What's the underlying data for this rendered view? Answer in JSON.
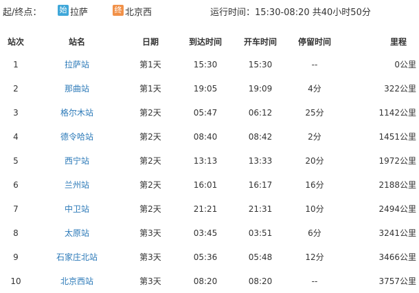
{
  "header": {
    "endpoints_label": "起/终点：",
    "start_badge": "始",
    "start_station": "拉萨",
    "end_badge": "终",
    "end_station": "北京西",
    "runtime": "运行时间：15:30-08:20 共40小时50分"
  },
  "colors": {
    "start_badge": "#3fa7d9",
    "end_badge": "#f19149",
    "station_link": "#2b79b8"
  },
  "table": {
    "headers": [
      "站次",
      "站名",
      "日期",
      "到达时间",
      "开车时间",
      "停留时间",
      "里程"
    ],
    "rows": [
      [
        "1",
        "拉萨站",
        "第1天",
        "15:30",
        "15:30",
        "--",
        "0公里"
      ],
      [
        "2",
        "那曲站",
        "第1天",
        "19:05",
        "19:09",
        "4分",
        "322公里"
      ],
      [
        "3",
        "格尔木站",
        "第2天",
        "05:47",
        "06:12",
        "25分",
        "1142公里"
      ],
      [
        "4",
        "德令哈站",
        "第2天",
        "08:40",
        "08:42",
        "2分",
        "1451公里"
      ],
      [
        "5",
        "西宁站",
        "第2天",
        "13:13",
        "13:33",
        "20分",
        "1972公里"
      ],
      [
        "6",
        "兰州站",
        "第2天",
        "16:01",
        "16:17",
        "16分",
        "2188公里"
      ],
      [
        "7",
        "中卫站",
        "第2天",
        "21:21",
        "21:31",
        "10分",
        "2494公里"
      ],
      [
        "8",
        "太原站",
        "第3天",
        "03:45",
        "03:51",
        "6分",
        "3241公里"
      ],
      [
        "9",
        "石家庄北站",
        "第3天",
        "05:36",
        "05:48",
        "12分",
        "3466公里"
      ],
      [
        "10",
        "北京西站",
        "第3天",
        "08:20",
        "08:20",
        "--",
        "3757公里"
      ]
    ]
  }
}
